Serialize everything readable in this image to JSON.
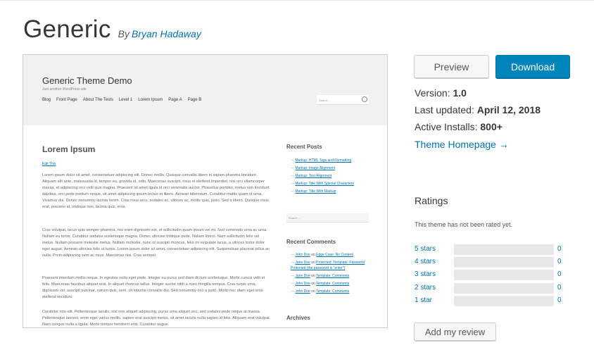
{
  "header": {
    "title": "Generic",
    "by_prefix": "By",
    "author": "Bryan Hadaway"
  },
  "preview": {
    "site_title": "Generic Theme Demo",
    "tagline": "Just another WordPress site",
    "nav": [
      "Blog",
      "Front Page",
      "About The Tests",
      "Level 1",
      "Lorem Ipsum",
      "Page A",
      "Page B"
    ],
    "search_placeholder": "Search ...",
    "post_title": "Lorem Ipsum",
    "edit_link": "Edit This",
    "paragraphs": [
      "Lorem ipsum dolor sit amet, consectetuer adipiscing elit. Donec mollis. Quisque convallis libero in sapien pharetra tincidunt. Aliquam elit ante, malesuada id, tempor eu, gravida id, odio. Maecenas suscipit, risus et eleifend imperdiet, nisi orci ullamcorper massa, et adipiscing orci velit quis magna. Praesent sit amet ligula id orci venenatis auctor. Phasellus porttitor, metus non tincidunt dapibus, orci pede pretium neque, sit amet adipiscing ipsum lectus et libero. Aenean bibendum. Curabitur mattis quam id urna. Vivamus dui. Donec nonummy lacinia lorem. Cras risus arcu, sodales ac, ultrices ac, mollis quis, justo. Sed a libero. Quisque risus erat, posuere at, tristique non, lacinia quis, eros.",
      "Cras volutpat, lacus quis semper pharetra, nisi enim dignissim est, et sollicitudin quam ipsum vel mi. Sed commodo urna ac urna. Nullam eu tortor. Curabitur sodales scelerisque magna. Donec ultricies tristique pede. Nullam libero. Nam sollicitudin felis vel metus. Nullam posuere molestie metus. Nullam molestie, nunc id suscipit rhoncus, felis mi vulputate lacus, a ultrices tortor dolor eget augue. Aenean ultricies felis ut turpis. Lorem ipsum dolor sit amet, consectetuer adipiscing elit. Suspendisse placerat tellus ac nulla. Proin adipiscing sem ac risus. Maecenas nisi. Cras semper.",
      "Praesent interdum mollis neque. In egestas nulla eget pede. Integer eu purus sed diam dictum scelerisque. Morbi cursus velit et felis. Maecenas faucibus aliquet erat. In aliquet rhoncus tellus. Integer auctor nibh a nunc fringilla tempus. Cras turpis urna, dignissim vel, suscipit pulvinar, rutrum quis, sem. Ut lobortis convallis dui. Sed nonummy orci a justo. Morbi nec diam eget eros eleifend tincidunt.",
      "Curabitur non elit. Pellentesque iaculis, nisl non aliquet adipiscing, purus urna aliquet orci, sed sodales pede neque at massa. Pellentesque laoreet, enim eget varius mollis, sapien erat suscipit metus, sit amet iaculis nulla sapien id felis. Aliquam erat volutpat. Nam congue nulla a ligula. Morbi tempor hendrerit erat. Curabitur augue."
    ],
    "recent_posts_heading": "Recent Posts",
    "recent_posts": [
      "Markup: HTML Tags and Formatting",
      "Markup: Image Alignment",
      "Markup: Text Alignment",
      "Markup: Title With Special Characters",
      "Markup: Title With Markup"
    ],
    "sidebar_search_placeholder": "Search ...",
    "recent_comments_heading": "Recent Comments",
    "recent_comments": [
      {
        "author": "John Doe",
        "on": "on",
        "post": "Edge Case: No Content"
      },
      {
        "author": "Jane Doe",
        "on": "on",
        "post": "Protected: Template: Password Protected (the password is \"enter\")"
      },
      {
        "author": "Jane Doe",
        "on": "on",
        "post": "Template: Comments"
      },
      {
        "author": "John Doe",
        "on": "on",
        "post": "Template: Comments"
      },
      {
        "author": "John Doe",
        "on": "on",
        "post": "Template: Comments"
      }
    ],
    "archives_heading": "Archives"
  },
  "actions": {
    "preview_label": "Preview",
    "download_label": "Download"
  },
  "meta": {
    "version_label": "Version:",
    "version_value": "1.0",
    "updated_label": "Last updated:",
    "updated_value": "April 12, 2018",
    "installs_label": "Active Installs:",
    "installs_value": "800+",
    "homepage_link": "Theme Homepage →"
  },
  "ratings": {
    "heading": "Ratings",
    "not_rated": "This theme has not been rated yet.",
    "rows": [
      {
        "label": "5 stars",
        "count": "0",
        "fraction": 0
      },
      {
        "label": "4 stars",
        "count": "0",
        "fraction": 0
      },
      {
        "label": "3 stars",
        "count": "0",
        "fraction": 0
      },
      {
        "label": "2 stars",
        "count": "0",
        "fraction": 0
      },
      {
        "label": "1 star",
        "count": "0",
        "fraction": 0
      }
    ],
    "add_review_label": "Add my review"
  }
}
